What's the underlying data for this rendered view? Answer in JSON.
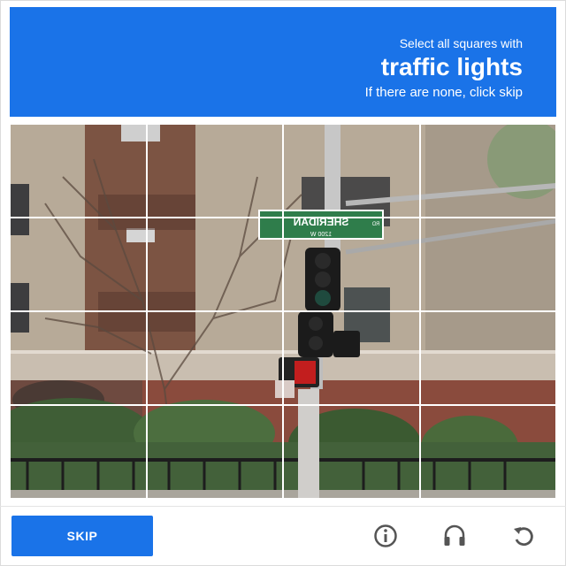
{
  "header": {
    "line1": "Select all squares with",
    "target": "traffic lights",
    "line3": "If there are none, click skip"
  },
  "image": {
    "sign_text": "SHERIDAN",
    "sign_subtext": "1200 W",
    "sign_suffix": "RD"
  },
  "grid": {
    "rows": 4,
    "cols": 4
  },
  "footer": {
    "skip_label": "SKIP",
    "icons": [
      "reload-icon",
      "audio-icon",
      "info-icon"
    ]
  },
  "colors": {
    "accent": "#1a73e8",
    "header_text": "#ffffff",
    "icon": "#555555"
  }
}
